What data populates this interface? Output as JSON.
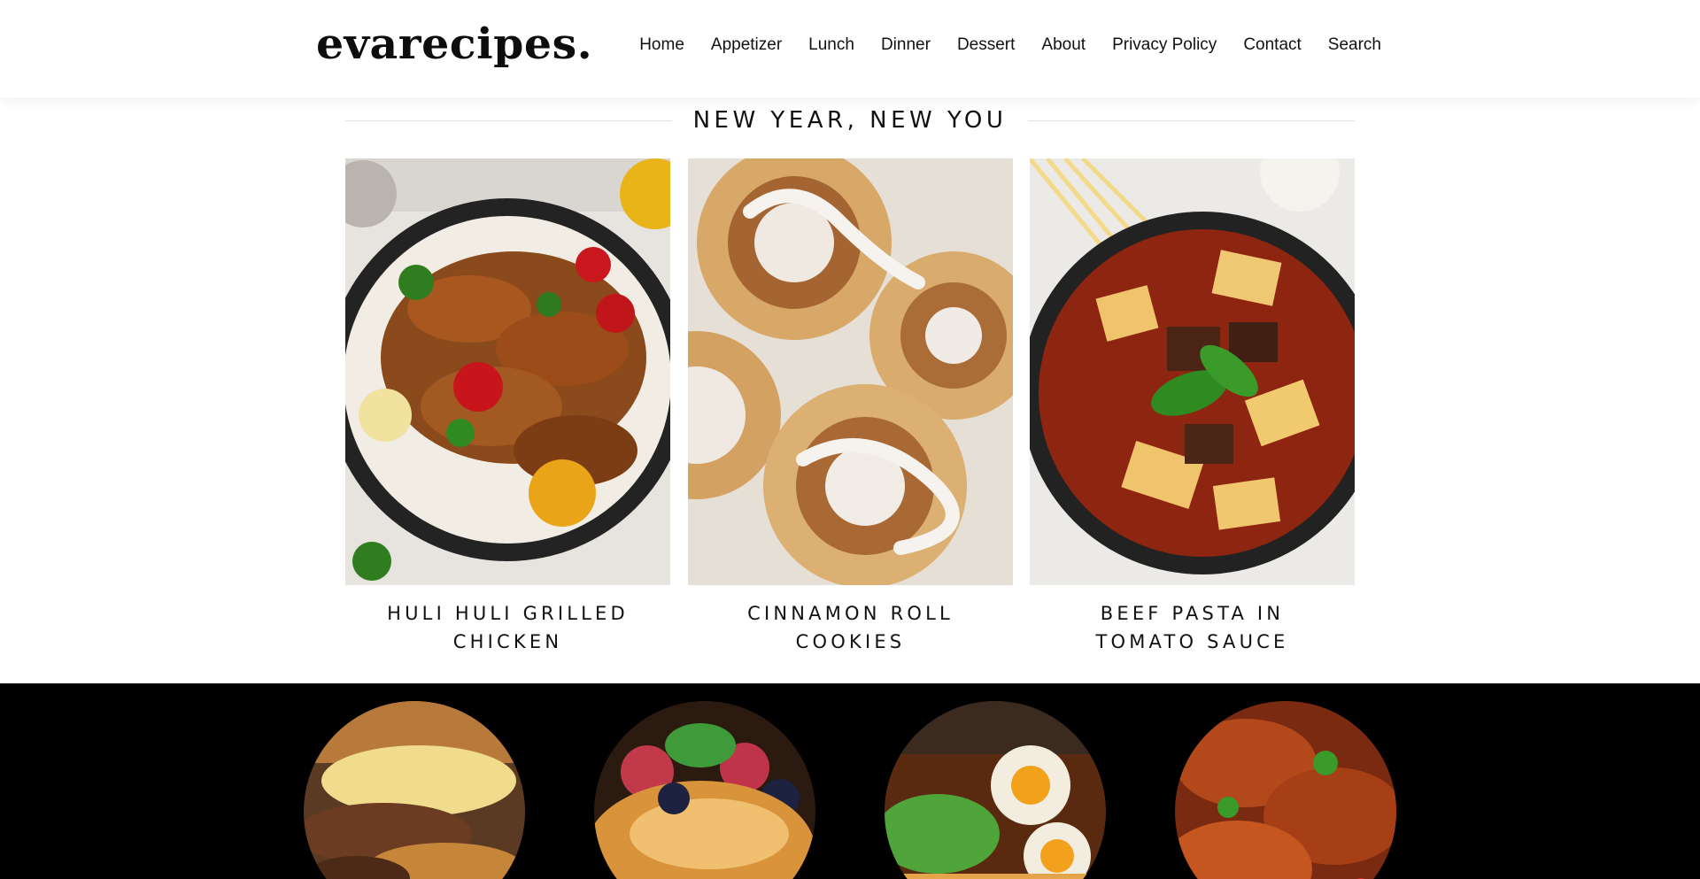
{
  "header": {
    "logo": "evarecipes.",
    "nav": [
      {
        "label": "Home"
      },
      {
        "label": "Appetizer"
      },
      {
        "label": "Lunch"
      },
      {
        "label": "Dinner"
      },
      {
        "label": "Dessert"
      },
      {
        "label": "About"
      },
      {
        "label": "Privacy Policy"
      },
      {
        "label": "Contact"
      },
      {
        "label": "Search"
      }
    ]
  },
  "featured": {
    "title": "NEW YEAR, NEW YOU",
    "cards": [
      {
        "title": "HULI HULI GRILLED CHICKEN"
      },
      {
        "title": "CINNAMON ROLL COOKIES"
      },
      {
        "title": "BEEF PASTA IN TOMATO SAUCE"
      }
    ]
  },
  "colors": {
    "text": "#111111",
    "background": "#ffffff",
    "dark_band": "#000000",
    "divider": "#e2e2e2"
  }
}
